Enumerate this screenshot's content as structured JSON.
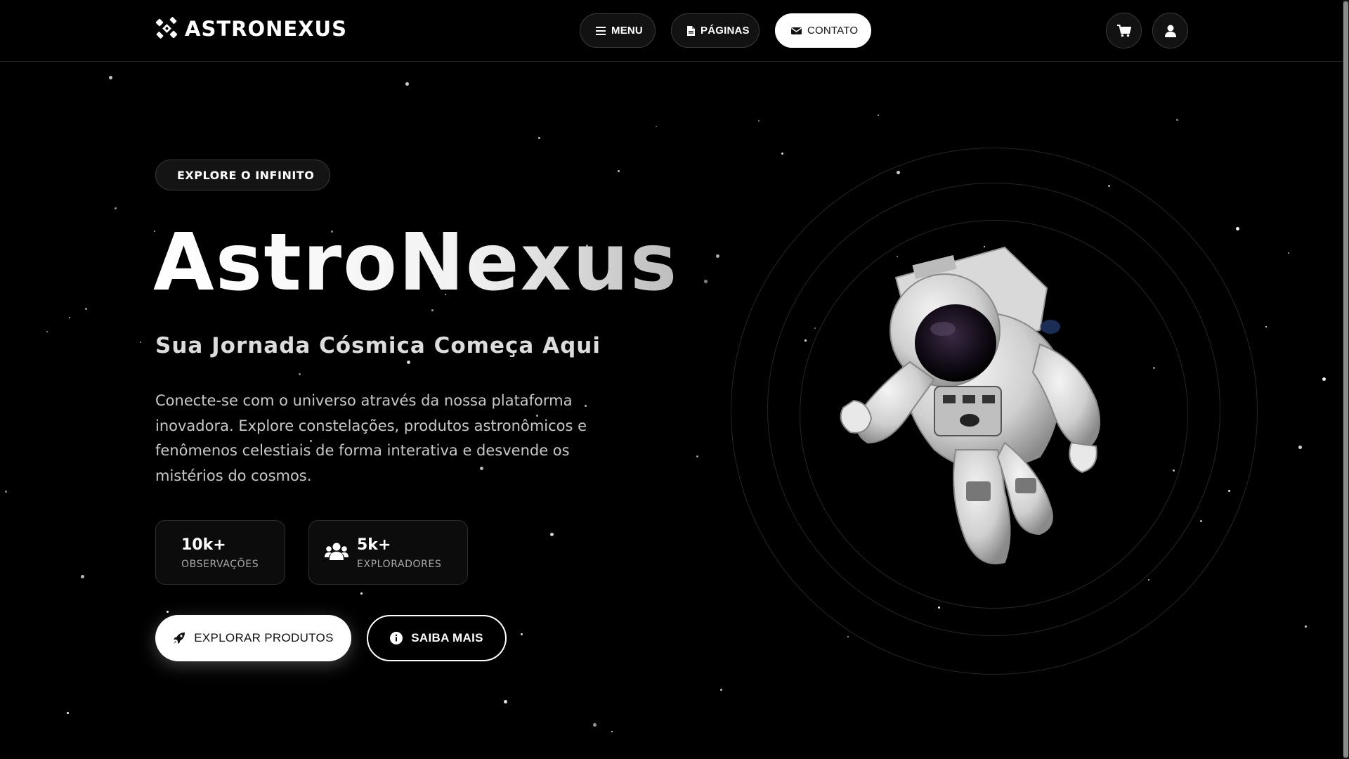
{
  "brand": {
    "name": "ASTRONEXUS"
  },
  "nav": {
    "menu_label": "MENU",
    "paginas_label": "PÁGINAS",
    "contato_label": "CONTATO"
  },
  "hero": {
    "badge": "EXPLORE O INFINITO",
    "title": "AstroNexus",
    "subtitle": "Sua Jornada Cósmica Começa Aqui",
    "description": "Conecte-se com o universo através da nossa plataforma inovadora. Explore constelações, produtos astronômicos e fenômenos celestiais de forma interativa e desvende os mistérios do cosmos.",
    "stats": [
      {
        "value": "10k+",
        "label": "OBSERVAÇÕES"
      },
      {
        "value": "5k+",
        "label": "EXPLORADORES",
        "icon": "users-icon"
      }
    ],
    "primary_cta": "EXPLORAR PRODUTOS",
    "secondary_cta": "SAIBA MAIS"
  },
  "icons": {
    "logo": "satellite-icon",
    "menu": "bars-icon",
    "paginas": "file-icon",
    "contato": "envelope-icon",
    "cart": "cart-icon",
    "user": "user-icon",
    "primary_cta": "rocket-icon",
    "secondary_cta": "info-circle-icon"
  },
  "colors": {
    "background": "#000000",
    "text": "#ffffff",
    "muted_text": "#c8c8c8",
    "border": "#3a3a3a"
  }
}
